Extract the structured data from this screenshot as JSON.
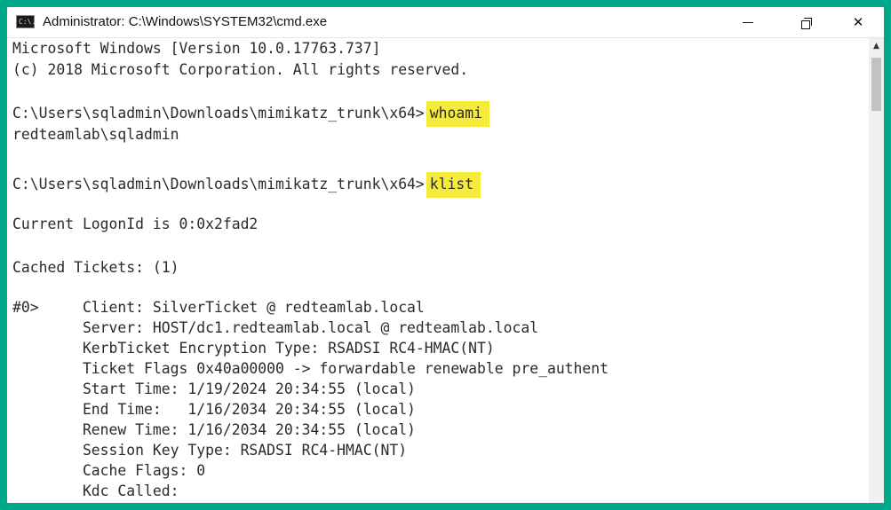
{
  "window": {
    "title": "Administrator: C:\\Windows\\SYSTEM32\\cmd.exe",
    "icon": "cmd-icon",
    "icon_text": "C:\\."
  },
  "controls": {
    "minimize": "minimize-icon",
    "maximize": "restore-icon",
    "close": "✕"
  },
  "console": {
    "lines": [
      "Microsoft Windows [Version 10.0.17763.737]",
      "(c) 2018 Microsoft Corporation. All rights reserved.",
      "",
      "C:\\Users\\sqladmin\\Downloads\\mimikatz_trunk\\x64>",
      "redteamlab\\sqladmin",
      "",
      "C:\\Users\\sqladmin\\Downloads\\mimikatz_trunk\\x64>",
      "",
      "Current LogonId is 0:0x2fad2",
      "",
      "Cached Tickets: (1)",
      "",
      "#0>     Client: SilverTicket @ redteamlab.local",
      "        Server: HOST/dc1.redteamlab.local @ redteamlab.local",
      "        KerbTicket Encryption Type: RSADSI RC4-HMAC(NT)",
      "        Ticket Flags 0x40a00000 -> forwardable renewable pre_authent",
      "        Start Time: 1/19/2024 20:34:55 (local)",
      "        End Time:   1/16/2034 20:34:55 (local)",
      "        Renew Time: 1/16/2034 20:34:55 (local)",
      "        Session Key Type: RSADSI RC4-HMAC(NT)",
      "        Cache Flags: 0",
      "        Kdc Called:"
    ],
    "commands": {
      "whoami": "whoami",
      "klist": "klist"
    },
    "highlight_color": "#f6ea3a"
  },
  "scrollbar": {
    "up_arrow": "▲"
  },
  "colors": {
    "border": "#00a88a",
    "text": "#2b2b2b",
    "background": "#ffffff"
  }
}
